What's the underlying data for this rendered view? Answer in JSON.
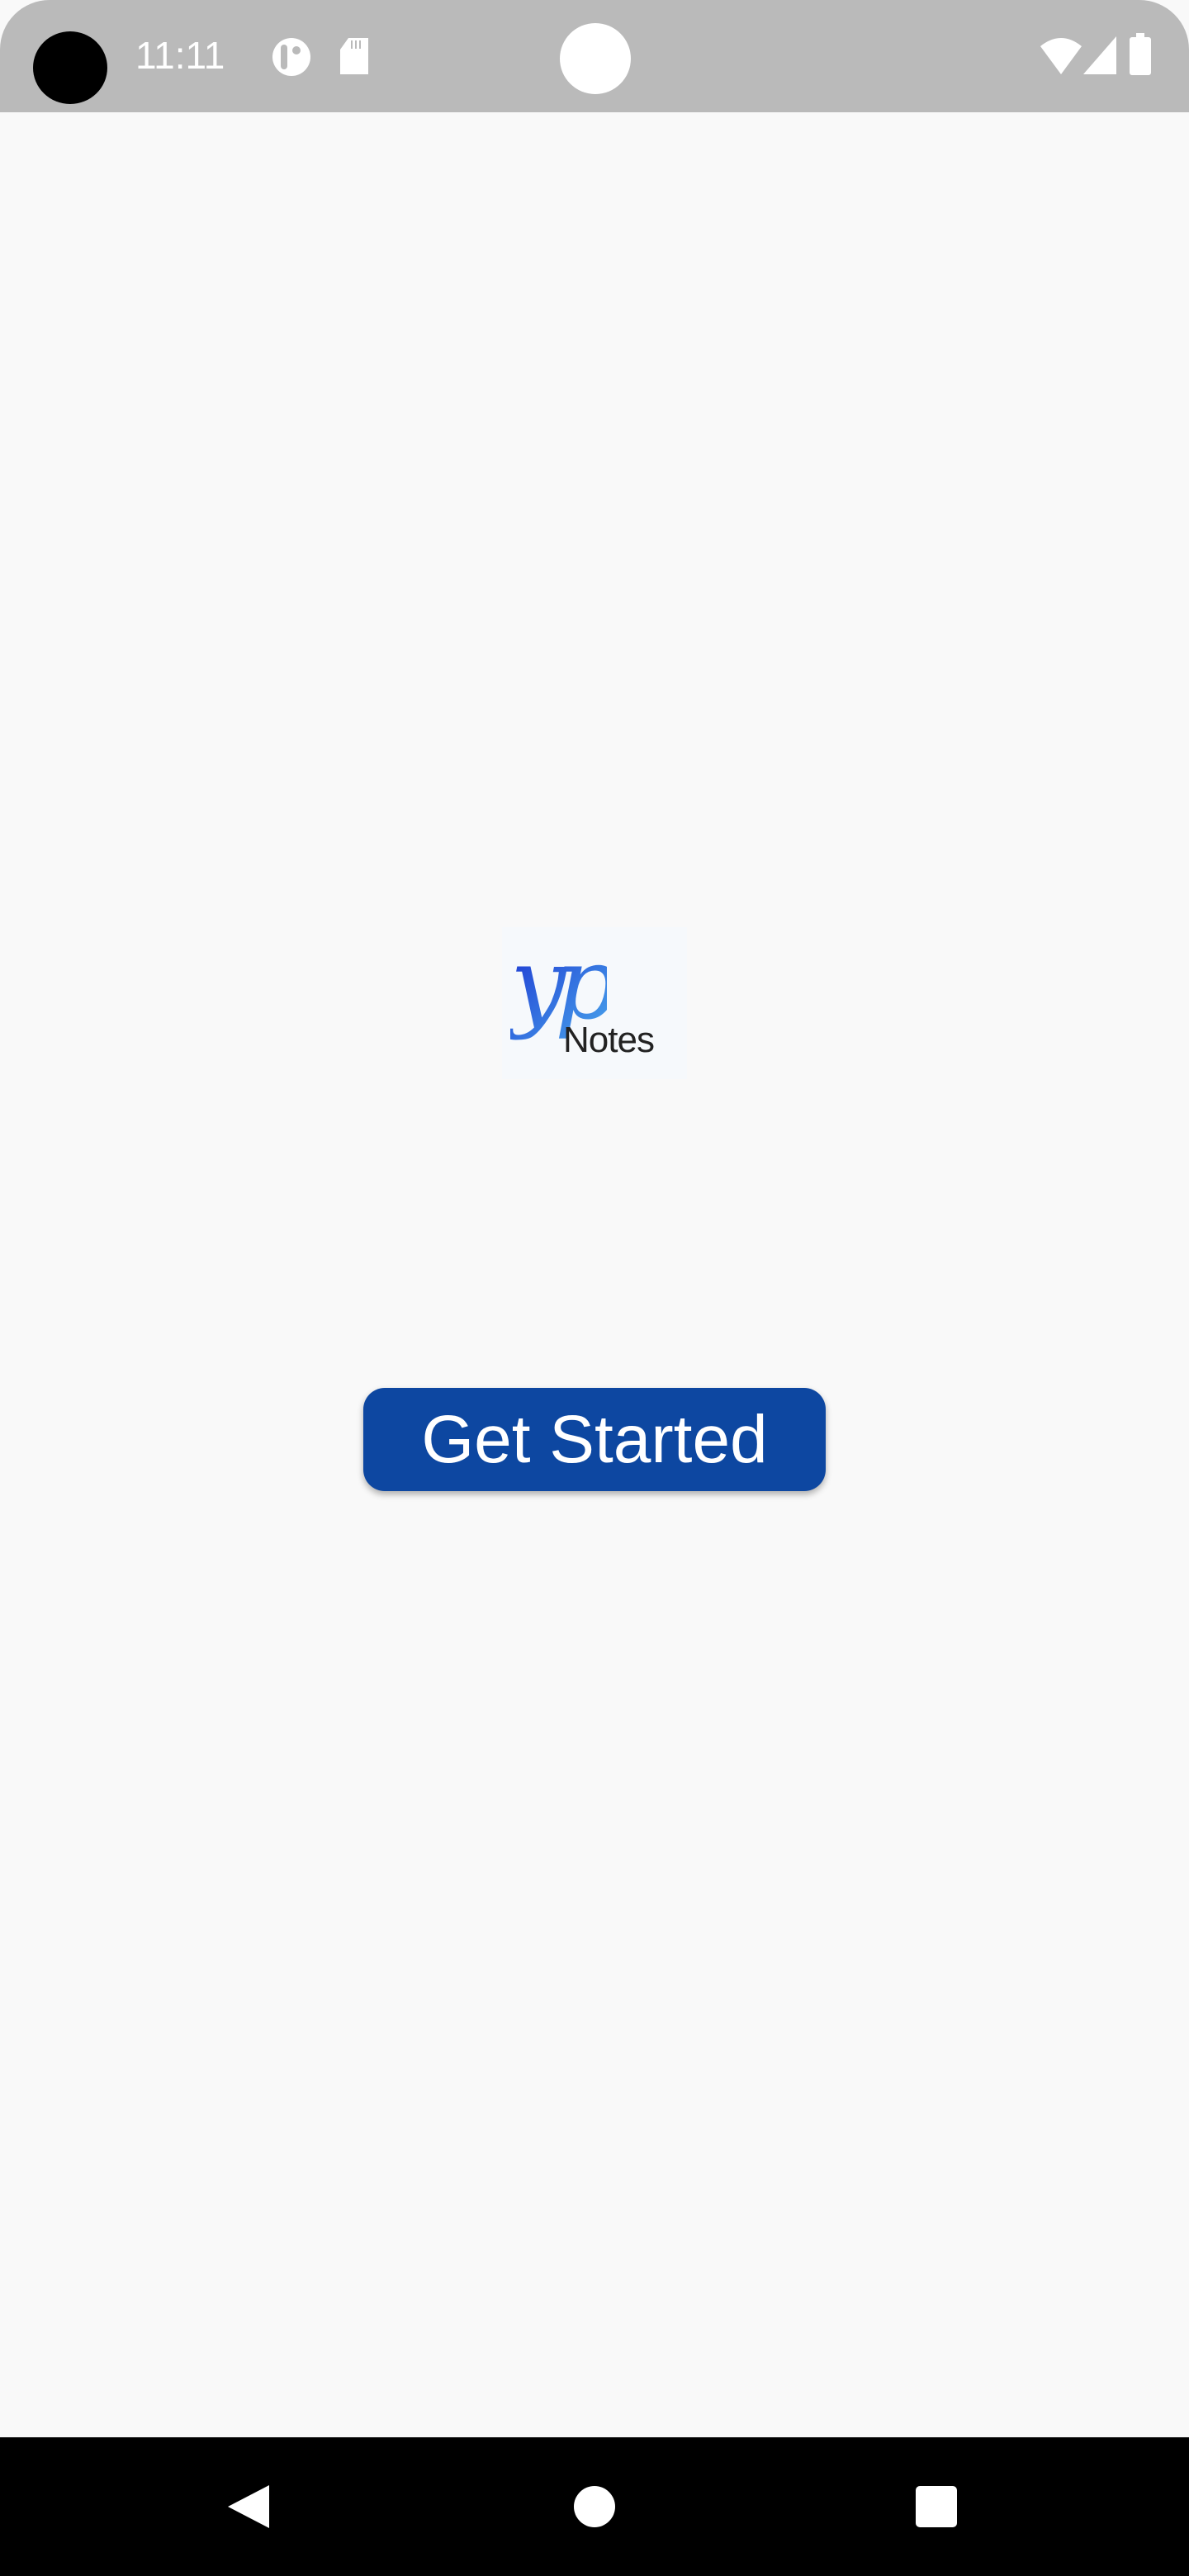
{
  "status_bar": {
    "time": "11:11",
    "icons": [
      "camera-cutout",
      "pocket-icon",
      "sd-card-icon",
      "wifi-icon",
      "signal-icon",
      "battery-icon"
    ]
  },
  "logo": {
    "mark": "yp",
    "text": "Notes"
  },
  "main": {
    "get_started_label": "Get Started",
    "button_color": "#0d47a1"
  },
  "nav_bar": {
    "buttons": [
      "back",
      "home",
      "recents"
    ]
  }
}
